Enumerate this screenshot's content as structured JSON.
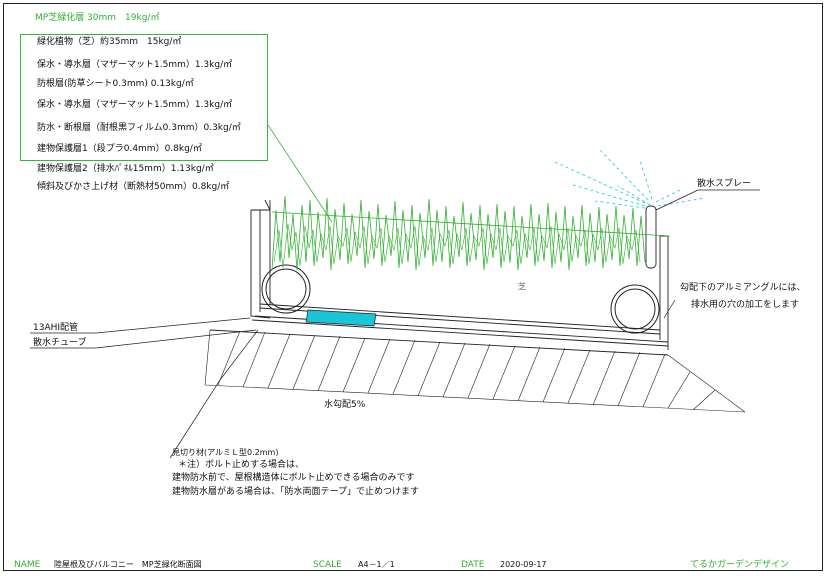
{
  "title_spec": "MP芝緑化層 30mm　19kg/㎡",
  "layers": [
    "緑化植物（芝）約35mm　15kg/㎡",
    "保水・導水層（マザーマット1.5mm）1.3kg/㎡",
    "防根層(防草シート0.3mm) 0.13kg/㎡",
    "保水・導水層（マザーマット1.5mm）1.3kg/㎡",
    "防水・断根層（耐根黒フィルム0.3mm）0.3kg/㎡",
    "建物保護層1（段プラ0.4mm）0.8kg/㎡"
  ],
  "extra_layers": [
    "建物保護層2（排水ﾊﾟﾈﾙ15mm）1.13kg/㎡",
    "傾斜及びかさ上げ材（断熱材50mm）0.8kg/㎡"
  ],
  "callouts": {
    "sprinkler": "散水スプレー",
    "angle_note_1": "勾配下のアルミアングルには、",
    "angle_note_2": "排水用の穴の加工をします",
    "pipe": "13AHI配管",
    "tube": "散水チューブ",
    "slope": "水勾配5%",
    "turf": "芝"
  },
  "notes": [
    "見切り材(アルミＬ型0.2mm)",
    "＊注）ボルト止めする場合は、",
    "建物防水前で、屋根構造体にボルト止めできる場合のみです",
    "建物防水層がある場合は、「防水両面テープ」で止めつけます"
  ],
  "titleblock": {
    "name_label": "NAME",
    "name": "陸屋根及びバルコニー　MP芝緑化断面図",
    "scale_label": "SCALE",
    "scale": "A4－1／1",
    "date_label": "DATE",
    "date": "2020-09-17",
    "company": "てるかガーデンデザイン"
  },
  "colors": {
    "grass": "#2fb12f",
    "drain_mat": "#19c6d8",
    "line": "#222222"
  }
}
